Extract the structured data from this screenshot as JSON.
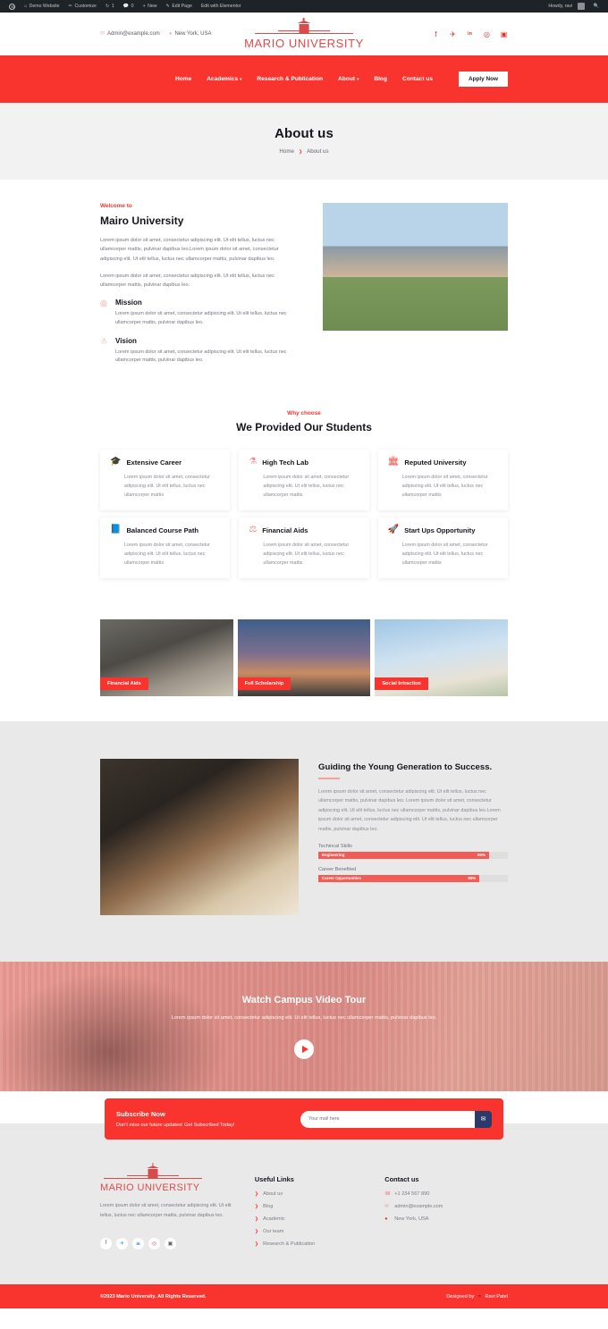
{
  "admin_bar": {
    "logo": "wordpress-logo",
    "items": [
      {
        "icon": "home-icon",
        "label": "Demo Website"
      },
      {
        "icon": "brush-icon",
        "label": "Customize"
      },
      {
        "icon": "updates-icon",
        "label": "1"
      },
      {
        "icon": "comment-icon",
        "label": "0"
      },
      {
        "icon": "plus-icon",
        "label": "New"
      },
      {
        "icon": "pencil-icon",
        "label": "Edit Page"
      },
      {
        "icon": "elementor-icon",
        "label": "Edit with Elementor"
      }
    ],
    "greeting": "Howdy, ravi",
    "search_icon": "search-icon"
  },
  "topbar": {
    "email": "Admin@example.com",
    "email_icon": "envelope-icon",
    "location": "New York, USA",
    "location_icon": "map-pin-icon",
    "logo_text": "MARIO UNIVERSITY",
    "socials": [
      {
        "name": "facebook-icon",
        "glyph": "f"
      },
      {
        "name": "twitter-icon",
        "glyph": "✈"
      },
      {
        "name": "linkedin-icon",
        "glyph": "in"
      },
      {
        "name": "dribbble-icon",
        "glyph": "◎"
      },
      {
        "name": "instagram-icon",
        "glyph": "▣"
      }
    ]
  },
  "nav": {
    "items": [
      {
        "label": "Home",
        "has_dropdown": false
      },
      {
        "label": "Academics",
        "has_dropdown": true
      },
      {
        "label": "Research & Publication",
        "has_dropdown": false
      },
      {
        "label": "About",
        "has_dropdown": true
      },
      {
        "label": "Blog",
        "has_dropdown": false
      },
      {
        "label": "Contact us",
        "has_dropdown": false
      }
    ],
    "cta": "Apply Now"
  },
  "page_header": {
    "title": "About us",
    "breadcrumb_home": "Home",
    "breadcrumb_sep": "❯",
    "breadcrumb_current": "About us"
  },
  "about": {
    "eyebrow": "Welcome to",
    "title": "Mairo University",
    "paragraph1": "Lorem ipsum dolor sit amet, consectetur adipiscing elit. Ut elit tellus, luctus nec ullamcorper mattis, pulvinar dapibus leo.Lorem ipsum dolor sit amet, consectetur adipiscing elit. Ut elit tellus, luctus nec ullamcorper mattis, pulvinar dapibus leo.",
    "paragraph2": "Lorem ipsum dolor sit amet, consectetur adipiscing elit. Ut elit tellus, luctus nec ullamcorper mattis, pulvinar dapibus leo.",
    "mission": {
      "icon": "target-icon",
      "title": "Mission",
      "text": "Lorem ipsum dolor sit amet, consectetur adipiscing elit. Ut elit tellus, luctus nec ullamcorper mattis, pulvinar dapibus leo."
    },
    "vision": {
      "icon": "lightbulb-icon",
      "title": "Vision",
      "text": "Lorem ipsum dolor sit amet, consectetur adipiscing elit. Ut elit tellus, luctus nec ullamcorper mattis, pulvinar dapibus leo."
    },
    "image_alt": "university-campus-building"
  },
  "why_choose": {
    "eyebrow": "Why choose",
    "title": "We Provided Our Students",
    "cards": [
      {
        "icon": "graduation-cap-icon",
        "title": "Extensive Career",
        "text": "Lorem ipsum dolor sit amet, consectetur adipiscing elit. Ut elit tellus, luctus nec ullamcorper mattis"
      },
      {
        "icon": "flask-icon",
        "title": "High Tech Lab",
        "text": "Lorem ipsum dolor sit amet, consectetur adipiscing elit. Ut elit tellus, luctus nec ullamcorper mattis"
      },
      {
        "icon": "bank-icon",
        "title": "Reputed University",
        "text": "Lorem ipsum dolor sit amet, consectetur adipiscing elit. Ut elit tellus, luctus nec ullamcorper mattis"
      },
      {
        "icon": "books-icon",
        "title": "Balanced Course Path",
        "text": "Lorem ipsum dolor sit amet, consectetur adipiscing elit. Ut elit tellus, luctus nec ullamcorper mattis"
      },
      {
        "icon": "money-hand-icon",
        "title": "Financial Aids",
        "text": "Lorem ipsum dolor sit amet, consectetur adipiscing elit. Ut elit tellus, luctus nec ullamcorper mattis"
      },
      {
        "icon": "rocket-icon",
        "title": "Start Ups Opportunity",
        "text": "Lorem ipsum dolor sit amet, consectetur adipiscing elit. Ut elit tellus, luctus nec ullamcorper mattis"
      }
    ]
  },
  "gallery": [
    {
      "tag": "Financial Aids",
      "alt": "students-with-laptops"
    },
    {
      "tag": "Full Scholarship",
      "alt": "graduates-throwing-caps"
    },
    {
      "tag": "Social Intraction",
      "alt": "student-outdoors"
    }
  ],
  "guiding": {
    "title": "Guiding the Young Generation to Success.",
    "paragraph": "Lorem ipsum dolor sit amet, consectetur adipiscing elit. Ut elit tellus, luctus nec ullamcorper mattis, pulvinar dapibus leo. Lorem ipsum dolor sit amet, consectetur adipiscing elit. Ut elit tellus, luctus nec ullamcorper mattis, pulvinar dapibus leo.Lorem ipsum dolor sit amet, consectetur adipiscing elit. Ut elit tellus, luctus nec ullamcorper mattis, pulvinar dapibus leo.",
    "image_alt": "graduate-in-cap",
    "bars": [
      {
        "label": "Techincal Skills",
        "name": "Engineering",
        "percent": "90%",
        "width": 90
      },
      {
        "label": "Career Benefited",
        "name": "Career Opportunities",
        "percent": "85%",
        "width": 85
      }
    ],
    "bar_color": "#f25c55"
  },
  "video": {
    "title": "Watch Campus Video Tour",
    "subtitle": "Lorem ipsum dolor sit amet, consectetur adipiscing elit. Ut elit tellus, luctus nec ullamcorper mattis, pulvinar dapibus leo.",
    "play_icon": "play-icon"
  },
  "subscribe": {
    "title": "Subscribe Now",
    "subtitle": "Don't miss our future updates! Get Subscribed Today!",
    "placeholder": "Your mail here",
    "value": "",
    "button_icon": "send-mail-icon"
  },
  "footer": {
    "logo_text": "MARIO UNIVERSITY",
    "about": "Lorem ipsum dolor sit amet, consectetur adipiscing elit. Ut elit tellus, luctus nec ullamcorper mattis, pulvinar dapibus leo.",
    "socials": [
      {
        "name": "facebook-icon",
        "glyph": "f",
        "cls": "fb"
      },
      {
        "name": "twitter-icon",
        "glyph": "✈",
        "cls": "tw"
      },
      {
        "name": "linkedin-icon",
        "glyph": "in",
        "cls": "li"
      },
      {
        "name": "dribbble-icon",
        "glyph": "◎",
        "cls": "dr"
      },
      {
        "name": "instagram-icon",
        "glyph": "▣",
        "cls": "ig"
      }
    ],
    "useful_links": {
      "heading": "Useful Links",
      "items": [
        "About us",
        "Blog",
        "Academic",
        "Our team",
        "Research & Publication"
      ]
    },
    "contact": {
      "heading": "Contact us",
      "items": [
        {
          "icon": "phone-icon",
          "text": "+1 234 567 890"
        },
        {
          "icon": "envelope-icon",
          "text": "admin@example.com"
        },
        {
          "icon": "map-pin-icon",
          "text": "New York, USA"
        }
      ]
    }
  },
  "copyright": {
    "text": "©2023 Mario University. All Rights Reserved.",
    "designed_label": "Designed by",
    "designer": "Ravi Patel"
  },
  "colors": {
    "primary_red": "#f9342e",
    "logo_red": "#e14a4a",
    "dark": "#15151c",
    "muted": "#8b8b95",
    "light_bg": "#e9e9e9",
    "admin_dark": "#1d2327"
  }
}
